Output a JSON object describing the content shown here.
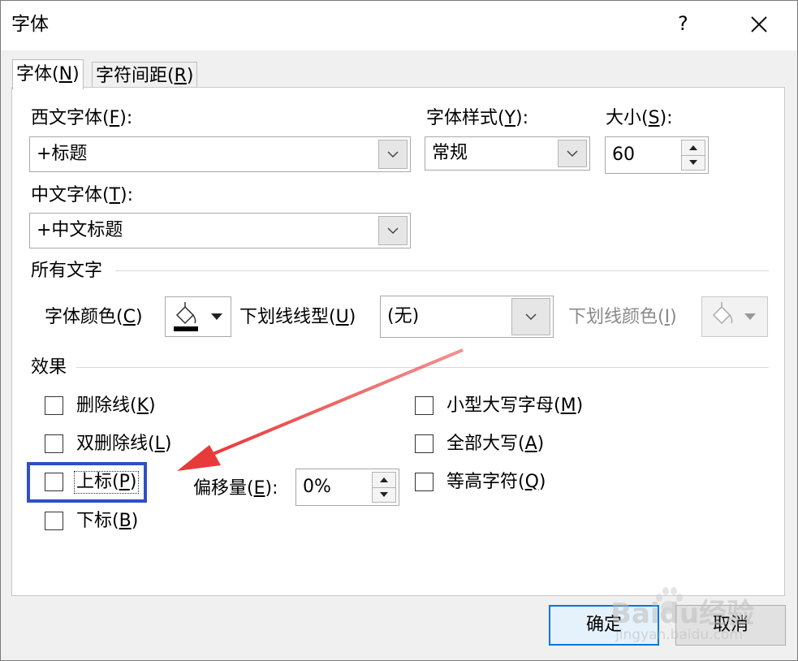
{
  "window": {
    "title": "字体",
    "help": "?",
    "close": "✕"
  },
  "tabs": [
    {
      "label": "字体(N)",
      "prefix": "字体(",
      "key": "N",
      "suffix": ")"
    },
    {
      "label": "字符间距(R)",
      "prefix": "字符间距(",
      "key": "R",
      "suffix": ")"
    }
  ],
  "fonts": {
    "western_label_prefix": "西文字体(",
    "western_key": "F",
    "western_label_suffix": "):",
    "western_value": "+标题",
    "style_label_prefix": "字体样式(",
    "style_key": "Y",
    "style_label_suffix": "):",
    "style_value": "常规",
    "size_label_prefix": "大小(",
    "size_key": "S",
    "size_label_suffix": "):",
    "size_value": "60",
    "chinese_label_prefix": "中文字体(",
    "chinese_key": "T",
    "chinese_label_suffix": "):",
    "chinese_value": "+中文标题"
  },
  "all_text": {
    "heading": "所有文字",
    "font_color_prefix": "字体颜色(",
    "font_color_key": "C",
    "font_color_suffix": ")",
    "font_color": "#000000",
    "underline_type_prefix": "下划线线型(",
    "underline_type_key": "U",
    "underline_type_suffix": ")",
    "underline_type_value": "(无)",
    "underline_color_prefix": "下划线颜色(",
    "underline_color_key": "I",
    "underline_color_suffix": ")"
  },
  "effects": {
    "heading": "效果",
    "strikethrough": {
      "prefix": "删除线(",
      "key": "K",
      "suffix": ")",
      "checked": false
    },
    "double_strikethrough": {
      "prefix": "双删除线(",
      "key": "L",
      "suffix": ")",
      "checked": false
    },
    "superscript": {
      "prefix": "上标(",
      "key": "P",
      "suffix": ")",
      "checked": false
    },
    "subscript": {
      "prefix": "下标(",
      "key": "B",
      "suffix": ")",
      "checked": false
    },
    "offset_prefix": "偏移量(",
    "offset_key": "E",
    "offset_suffix": "):",
    "offset_value": "0%",
    "small_caps": {
      "prefix": "小型大写字母(",
      "key": "M",
      "suffix": ")",
      "checked": false
    },
    "all_caps": {
      "prefix": "全部大写(",
      "key": "A",
      "suffix": ")",
      "checked": false
    },
    "equalize_height": {
      "prefix": "等高字符(",
      "key": "Q",
      "suffix": ")",
      "checked": false
    }
  },
  "buttons": {
    "ok": "确定",
    "cancel": "取消"
  },
  "annotation": {
    "highlight_color": "#2d50c8",
    "arrow_color": "#e83a3a"
  },
  "watermark": {
    "brand": "Baidu经验",
    "url": "jingyan.baidu.com"
  }
}
